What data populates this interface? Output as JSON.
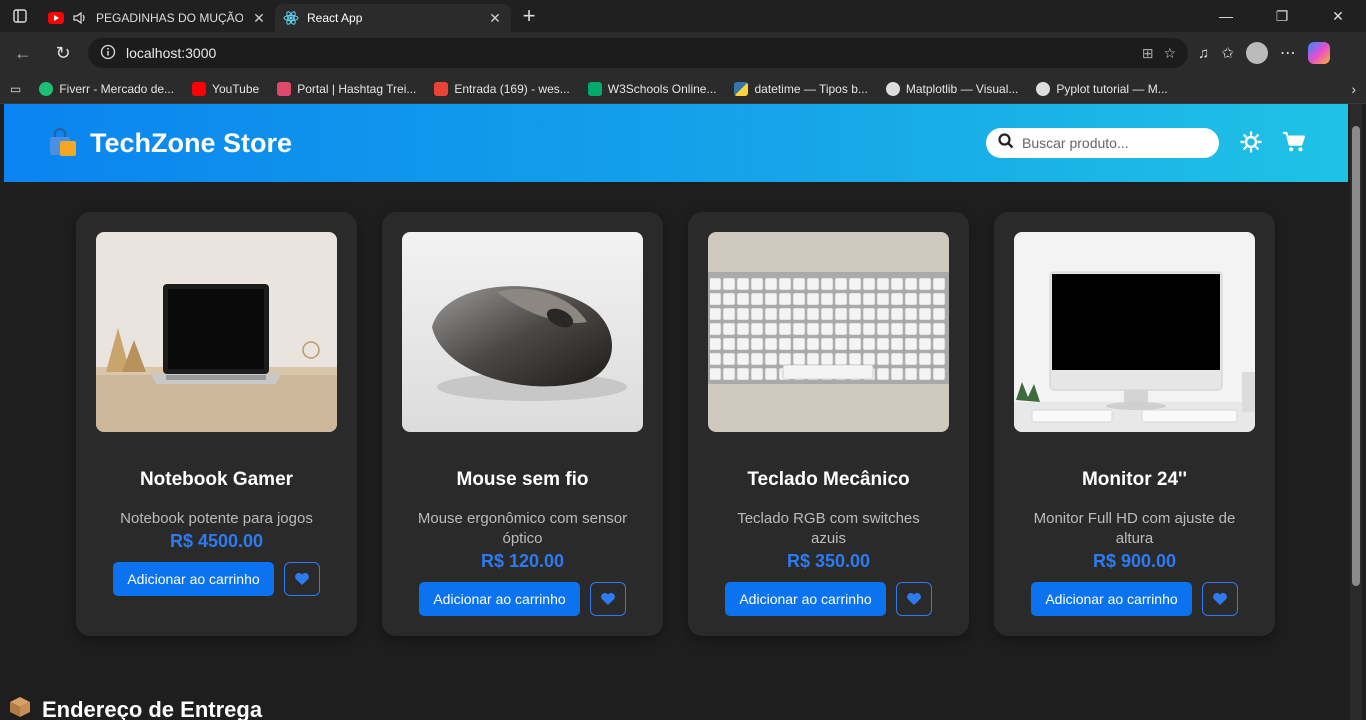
{
  "browser": {
    "tabs": [
      {
        "title": "PEGADINHAS DO MUÇÃO 🔹",
        "active": false
      },
      {
        "title": "React App",
        "active": true
      }
    ],
    "url": "localhost:3000",
    "bookmarks": [
      {
        "label": "Fiverr - Mercado de...",
        "icon": "fiverr-icon",
        "color": "#1dbf73"
      },
      {
        "label": "YouTube",
        "icon": "youtube-icon",
        "color": "#ff0000"
      },
      {
        "label": "Portal | Hashtag Trei...",
        "icon": "hashtag-icon",
        "color": "#e04a6a"
      },
      {
        "label": "Entrada (169) - wes...",
        "icon": "gmail-icon",
        "color": "#ea4335"
      },
      {
        "label": "W3Schools Online...",
        "icon": "w3schools-icon",
        "color": "#04aa6d"
      },
      {
        "label": "datetime — Tipos b...",
        "icon": "python-icon",
        "color": "#3776ab"
      },
      {
        "label": "Matplotlib — Visual...",
        "icon": "matplotlib-icon",
        "color": "#dddddd"
      },
      {
        "label": "Pyplot tutorial — M...",
        "icon": "matplotlib-icon",
        "color": "#dddddd"
      }
    ]
  },
  "store": {
    "title": "TechZone Store",
    "search_placeholder": "Buscar produto...",
    "accent": "#0b72f0"
  },
  "products": [
    {
      "name": "Notebook Gamer",
      "description": "Notebook potente para jogos",
      "price": "R$ 4500.00",
      "button": "Adicionar ao carrinho"
    },
    {
      "name": "Mouse sem fio",
      "description": "Mouse ergonômico com sensor óptico",
      "price": "R$ 120.00",
      "button": "Adicionar ao carrinho"
    },
    {
      "name": "Teclado Mecânico",
      "description": "Teclado RGB com switches azuis",
      "price": "R$ 350.00",
      "button": "Adicionar ao carrinho"
    },
    {
      "name": "Monitor 24''",
      "description": "Monitor Full HD com ajuste de altura",
      "price": "R$ 900.00",
      "button": "Adicionar ao carrinho"
    }
  ],
  "sections": {
    "address_title": "Endereço de Entrega"
  }
}
